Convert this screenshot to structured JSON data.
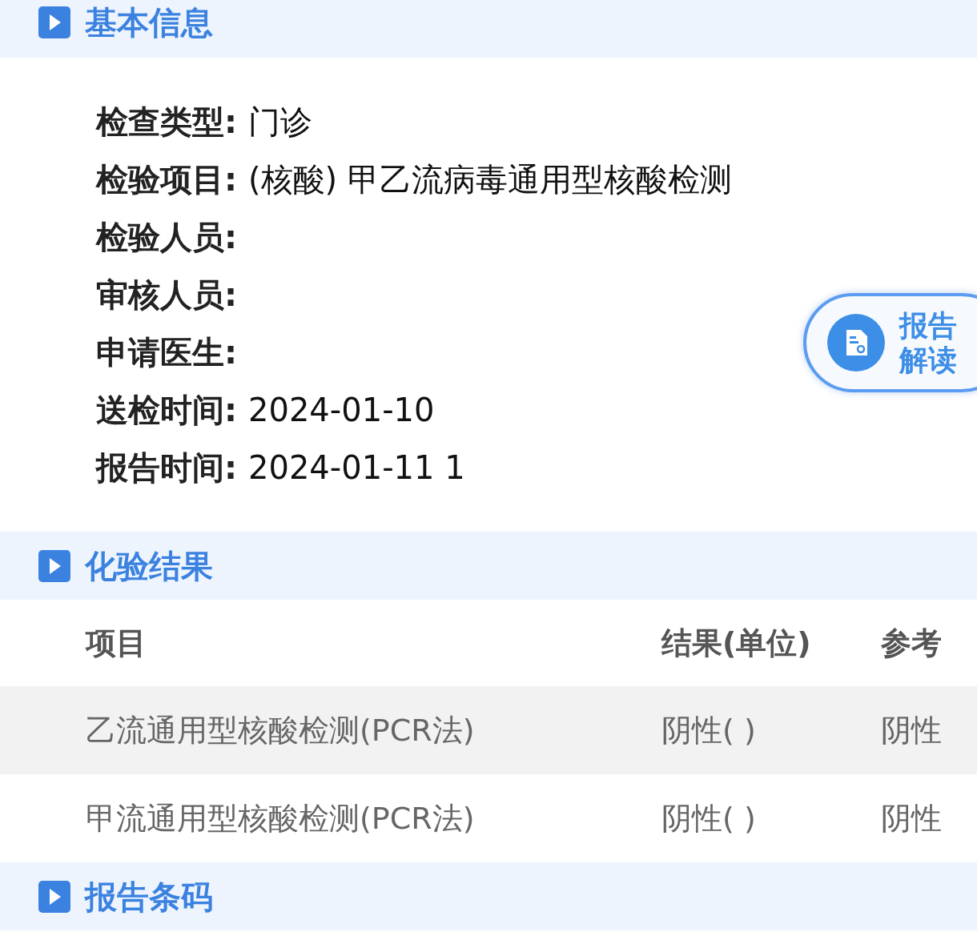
{
  "sections": [
    {
      "title": "基本信息",
      "kind": "info",
      "fields": [
        {
          "label": "检查类型:",
          "value": "门诊"
        },
        {
          "label": "检验项目:",
          "value": "(核酸) 甲乙流病毒通用型核酸检测"
        },
        {
          "label": "检验人员:"
        },
        {
          "label": "审核人员:"
        },
        {
          "label": "申请医生:"
        },
        {
          "label": "送检时间:",
          "value": "2024-01-10"
        },
        {
          "label": "报告时间:",
          "value": "2024-01-11 1"
        }
      ]
    },
    {
      "title": "化验结果",
      "kind": "table",
      "columns": [
        "项目",
        "结果(单位)",
        "参考"
      ],
      "rows": [
        {
          "cells": [
            "乙流通用型核酸检测(PCR法)",
            "阴性( )",
            "阴性"
          ]
        },
        {
          "cells": [
            "甲流通用型核酸检测(PCR法)",
            "阴性( )",
            "阴性"
          ]
        }
      ]
    },
    {
      "title": "报告条码",
      "kind": "header"
    }
  ],
  "float_button": {
    "label": "报告解读"
  }
}
